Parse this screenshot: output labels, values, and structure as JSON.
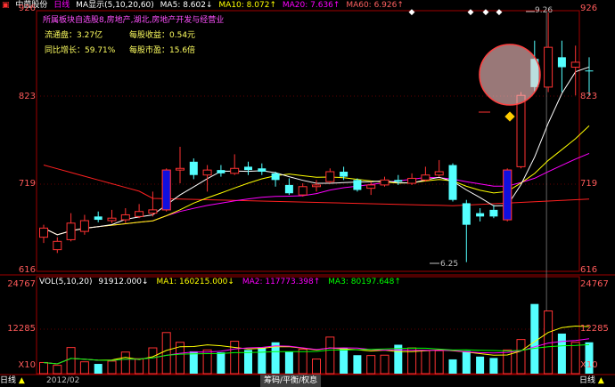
{
  "header": {
    "stock_name": "中茵股份",
    "period": "日线",
    "ma_label": "MA显示(5,10,20,60)",
    "ma5": "MA5: 8.602↓",
    "ma10": "MA10: 8.072↑",
    "ma20": "MA20: 7.636↑",
    "ma60": "MA60: 6.926↑"
  },
  "info": {
    "sector": "所属板块自选股8,房地产,湖北,房地产开发与经营业",
    "float_cap": "流通盘：3.27亿",
    "eps": "每股收益：0.54元",
    "growth": "同比增长：59.71%",
    "pe": "每股市盈：15.6倍"
  },
  "price_axis": {
    "top": "926",
    "mid": "823",
    "mid2": "719",
    "bottom": "616"
  },
  "annotations": {
    "high": "9.26",
    "low": "6.25"
  },
  "volume_header": {
    "vol": "VOL(5,10,20)",
    "value": "91912.000↓",
    "ma1": "MA1: 160215.000↓",
    "ma2": "MA2: 117773.398↑",
    "ma3": "MA3: 80197.648↑"
  },
  "vol_axis": {
    "top": "24767",
    "mid": "12285",
    "bottom_l": "X10",
    "bottom_r": "X10"
  },
  "bottom": {
    "left_tab": "日线",
    "date": "2012/02",
    "tabs": "筹码/平衡/权息",
    "right_tab": "日线"
  },
  "colors": {
    "up": "#ff3232",
    "down": "#54ffff",
    "ma5": "#ffffff",
    "ma10": "#ffff00",
    "ma20": "#ff00ff",
    "ma60": "#ff2020"
  },
  "chart_data": {
    "type": "candlestick",
    "candles": [
      {
        "o": 6.55,
        "c": 6.66,
        "h": 6.7,
        "l": 6.48
      },
      {
        "o": 6.4,
        "c": 6.5,
        "h": 6.55,
        "l": 6.36
      },
      {
        "o": 6.52,
        "c": 6.72,
        "h": 6.84,
        "l": 6.5
      },
      {
        "o": 6.62,
        "c": 6.75,
        "h": 6.82,
        "l": 6.58
      },
      {
        "o": 6.8,
        "c": 6.76,
        "h": 6.86,
        "l": 6.73
      },
      {
        "o": 6.75,
        "c": 6.78,
        "h": 6.88,
        "l": 6.72
      },
      {
        "o": 6.76,
        "c": 6.82,
        "h": 6.9,
        "l": 6.72
      },
      {
        "o": 6.8,
        "c": 6.86,
        "h": 6.95,
        "l": 6.78
      },
      {
        "o": 6.84,
        "c": 6.88,
        "h": 7.1,
        "l": 6.8
      },
      {
        "o": 6.88,
        "c": 7.36,
        "h": 7.38,
        "l": 6.86
      },
      {
        "o": 7.36,
        "c": 7.38,
        "h": 7.64,
        "l": 7.2
      },
      {
        "o": 7.46,
        "c": 7.3,
        "h": 7.5,
        "l": 7.25
      },
      {
        "o": 7.3,
        "c": 7.36,
        "h": 7.42,
        "l": 7.1
      },
      {
        "o": 7.36,
        "c": 7.32,
        "h": 7.42,
        "l": 7.28
      },
      {
        "o": 7.32,
        "c": 7.38,
        "h": 7.55,
        "l": 7.3
      },
      {
        "o": 7.4,
        "c": 7.36,
        "h": 7.46,
        "l": 7.3
      },
      {
        "o": 7.38,
        "c": 7.34,
        "h": 7.44,
        "l": 7.3
      },
      {
        "o": 7.32,
        "c": 7.24,
        "h": 7.34,
        "l": 7.16
      },
      {
        "o": 7.18,
        "c": 7.08,
        "h": 7.26,
        "l": 7.06
      },
      {
        "o": 7.06,
        "c": 7.16,
        "h": 7.2,
        "l": 7.04
      },
      {
        "o": 7.16,
        "c": 7.18,
        "h": 7.24,
        "l": 7.1
      },
      {
        "o": 7.22,
        "c": 7.34,
        "h": 7.38,
        "l": 7.2
      },
      {
        "o": 7.34,
        "c": 7.28,
        "h": 7.4,
        "l": 7.24
      },
      {
        "o": 7.24,
        "c": 7.12,
        "h": 7.26,
        "l": 7.1
      },
      {
        "o": 7.14,
        "c": 7.18,
        "h": 7.22,
        "l": 7.06
      },
      {
        "o": 7.18,
        "c": 7.24,
        "h": 7.28,
        "l": 7.16
      },
      {
        "o": 7.24,
        "c": 7.22,
        "h": 7.3,
        "l": 7.18
      },
      {
        "o": 7.2,
        "c": 7.26,
        "h": 7.32,
        "l": 7.18
      },
      {
        "o": 7.24,
        "c": 7.3,
        "h": 7.4,
        "l": 7.22
      },
      {
        "o": 7.3,
        "c": 7.34,
        "h": 7.48,
        "l": 7.28
      },
      {
        "o": 7.42,
        "c": 7.0,
        "h": 7.44,
        "l": 6.98
      },
      {
        "o": 6.96,
        "c": 6.7,
        "h": 7.0,
        "l": 6.25
      },
      {
        "o": 6.84,
        "c": 6.8,
        "h": 6.9,
        "l": 6.74
      },
      {
        "o": 6.88,
        "c": 6.8,
        "h": 6.94,
        "l": 6.78
      },
      {
        "o": 6.76,
        "c": 7.36,
        "h": 7.38,
        "l": 6.74
      },
      {
        "o": 7.4,
        "c": 8.26,
        "h": 8.3,
        "l": 7.38
      },
      {
        "o": 8.7,
        "c": 8.36,
        "h": 8.92,
        "l": 8.3
      },
      {
        "o": 8.36,
        "c": 8.84,
        "h": 9.26,
        "l": 8.3
      },
      {
        "o": 8.72,
        "c": 8.6,
        "h": 8.92,
        "l": 8.3
      },
      {
        "o": 8.6,
        "c": 8.66,
        "h": 8.86,
        "l": 8.26
      },
      {
        "o": 8.56,
        "c": 8.55,
        "h": 8.72,
        "l": 8.26
      }
    ],
    "volume": [
      3.2,
      2.4,
      7.5,
      3.4,
      2.8,
      3.6,
      6.2,
      4.3,
      7.4,
      11.8,
      9.0,
      6.4,
      6.8,
      6.1,
      9.3,
      6.8,
      7.4,
      9.0,
      6.3,
      7.0,
      4.2,
      10.5,
      7.4,
      5.3,
      5.2,
      5.3,
      8.3,
      7.4,
      6.6,
      6.6,
      4.1,
      6.5,
      4.9,
      4.5,
      6.8,
      9.8,
      20.0,
      18.0,
      11.5,
      9.0,
      9.0
    ],
    "ylim": [
      6.16,
      9.26
    ],
    "vol_max": 24.767
  }
}
